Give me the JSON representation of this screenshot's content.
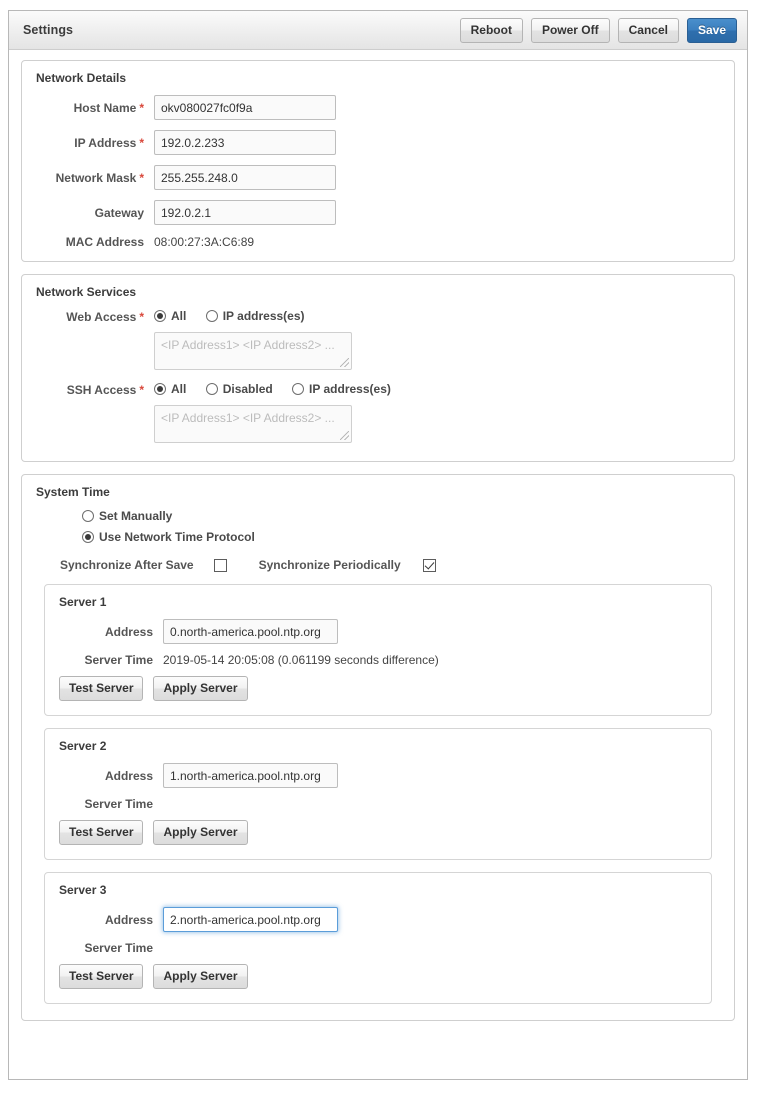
{
  "window": {
    "title": "Settings",
    "actions": [
      {
        "label": "Reboot",
        "name": "reboot-button",
        "primary": false
      },
      {
        "label": "Power Off",
        "name": "power-off-button",
        "primary": false
      },
      {
        "label": "Cancel",
        "name": "cancel-button",
        "primary": false
      },
      {
        "label": "Save",
        "name": "save-button",
        "primary": true
      }
    ]
  },
  "colors": {
    "primary_button": "#3b7fbf",
    "required_marker": "#d9483b",
    "focus_ring": "#5b9dd9",
    "panel_border": "#cfcfcf"
  },
  "network_details": {
    "title": "Network Details",
    "host_name": {
      "label": "Host Name",
      "required": "*",
      "value": "okv080027fc0f9a"
    },
    "ip_address": {
      "label": "IP Address",
      "required": "*",
      "value": "192.0.2.233"
    },
    "network_mask": {
      "label": "Network Mask",
      "required": "*",
      "value": "255.255.248.0"
    },
    "gateway": {
      "label": "Gateway",
      "required": "",
      "value": "192.0.2.1"
    },
    "mac_address": {
      "label": "MAC Address",
      "value": "08:00:27:3A:C6:89"
    }
  },
  "network_services": {
    "title": "Network Services",
    "web_access": {
      "label": "Web Access",
      "required": "*",
      "options": [
        {
          "label": "All",
          "selected": true
        },
        {
          "label": "IP address(es)",
          "selected": false
        }
      ],
      "ip_list_value": "",
      "ip_list_placeholder": "<IP Address1> <IP Address2> ..."
    },
    "ssh_access": {
      "label": "SSH Access",
      "required": "*",
      "options": [
        {
          "label": "All",
          "selected": true
        },
        {
          "label": "Disabled",
          "selected": false
        },
        {
          "label": "IP address(es)",
          "selected": false
        }
      ],
      "ip_list_value": "",
      "ip_list_placeholder": "<IP Address1> <IP Address2> ..."
    }
  },
  "system_time": {
    "title": "System Time",
    "modes": [
      {
        "label": "Set Manually",
        "selected": false
      },
      {
        "label": "Use Network Time Protocol",
        "selected": true
      }
    ],
    "sync_after_save": {
      "label": "Synchronize After Save",
      "checked": false
    },
    "sync_periodically": {
      "label": "Synchronize Periodically",
      "checked": true
    },
    "address_label": "Address",
    "server_time_label": "Server Time",
    "test_button": "Test Server",
    "apply_button": "Apply Server",
    "servers": [
      {
        "title": "Server 1",
        "address": "0.north-america.pool.ntp.org",
        "server_time": "2019-05-14 20:05:08 (0.061199 seconds difference)",
        "focused": false
      },
      {
        "title": "Server 2",
        "address": "1.north-america.pool.ntp.org",
        "server_time": "",
        "focused": false
      },
      {
        "title": "Server 3",
        "address": "2.north-america.pool.ntp.org",
        "server_time": "",
        "focused": true
      }
    ]
  }
}
